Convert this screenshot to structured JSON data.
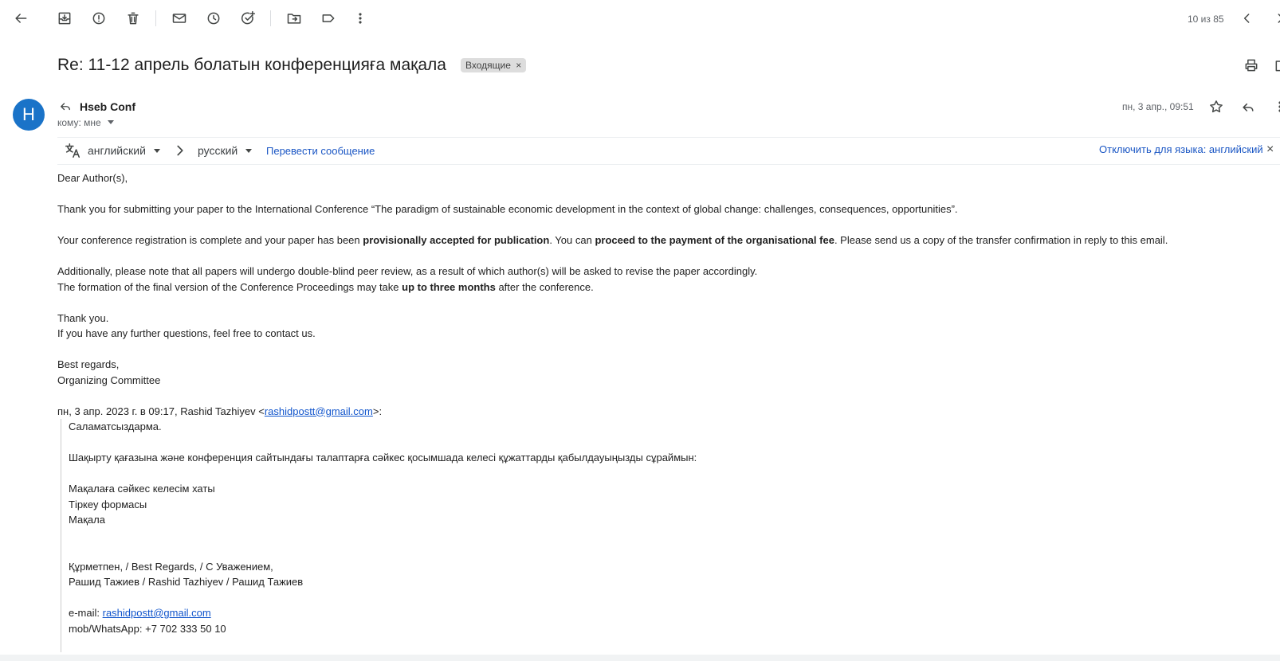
{
  "toolbar": {
    "counter": "10 из 85"
  },
  "subject": {
    "title": "Re: 11-12 апрель болатын конференцияға мақала",
    "label": "Входящие",
    "label_close": "×"
  },
  "message": {
    "avatar_letter": "H",
    "sender": "Hseb Conf",
    "to": "кому: мне",
    "date": "пн, 3 апр., 09:51"
  },
  "translate": {
    "from": "английский",
    "to": "русский",
    "action": "Перевести сообщение",
    "disable": "Отключить для языка: английский",
    "close": "×"
  },
  "body": {
    "greeting": "Dear Author(s),",
    "p1": "Thank you for submitting your paper to the International Conference “The paradigm of sustainable economic development in the context of global change: challenges, consequences, opportunities”.",
    "p2_a": "Your conference registration is complete and your paper has been ",
    "p2_b": "provisionally accepted for publication",
    "p2_c": ". You can ",
    "p2_d": "proceed to the payment of the organisational fee",
    "p2_e": ". Please send us a copy of the transfer confirmation in reply to this email.",
    "p3": "Additionally, please note that all papers will undergo double-blind peer review, as a result of which author(s) will be asked to revise the paper accordingly.",
    "p4_a": "The formation of the final version of the Conference Proceedings may take ",
    "p4_b": "up to three months",
    "p4_c": " after the conference.",
    "thanks": "Thank you.",
    "questions": "If you have any further questions, feel free to contact us.",
    "regards": "Best regards,",
    "committee": "Organizing Committee",
    "quote_header_a": "пн, 3 апр. 2023 г. в 09:17, Rashid Tazhiyev <",
    "quote_email": "rashidpostt@gmail.com",
    "quote_header_b": ">:"
  },
  "quote": {
    "hello": "Саламатсыздарма.",
    "request": "Шақырту қағазына және конференция сайтындағы талаптарға сәйкес қосымшада келесі құжаттарды қабылдауыңызды сұраймын:",
    "doc1": "Мақалаға сәйкес келесім хаты",
    "doc2": "Тіркеу формасы",
    "doc3": "Мақала",
    "signoff": "Құрметпен, / Best Regards, / С Уважением,",
    "name": "Рашид Тажиев / Rashid Tazhiyev / Рашид Тажиев",
    "email_label": "e-mail: ",
    "email": "rashidpostt@gmail.com",
    "phone": "mob/WhatsApp: +7 702 333 50 10"
  }
}
